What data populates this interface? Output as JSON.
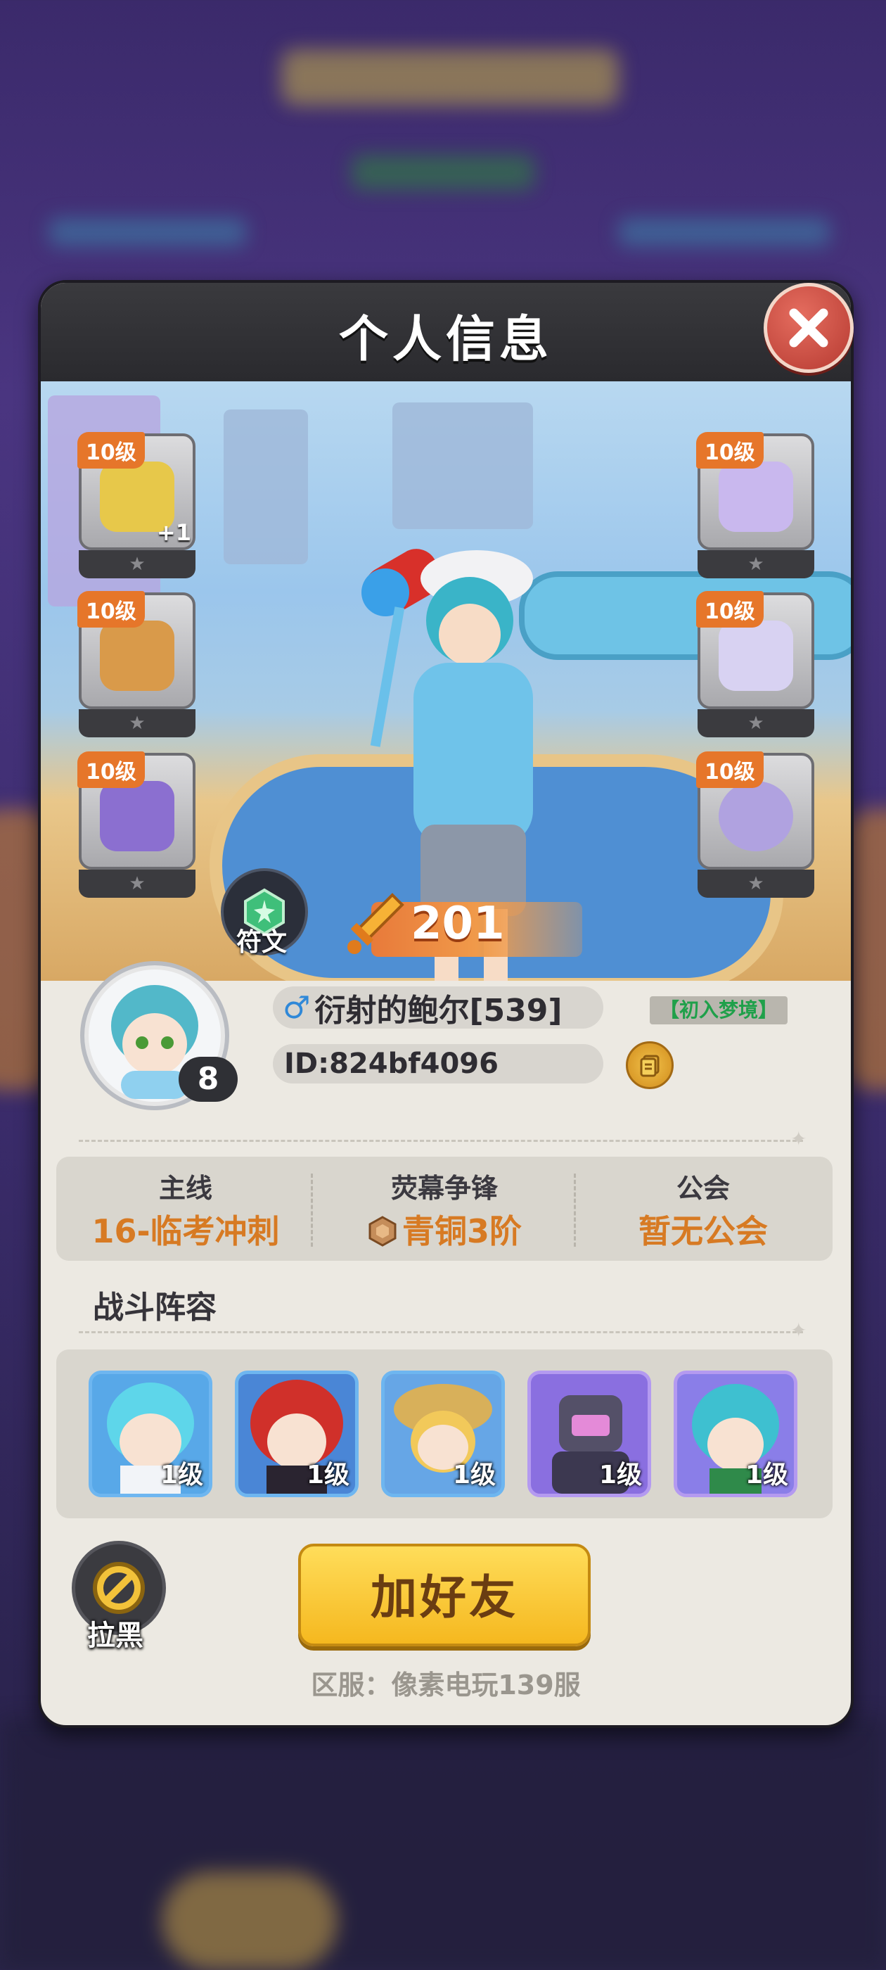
{
  "dialog": {
    "title": "个人信息"
  },
  "equipment": {
    "left": [
      {
        "level": "10级",
        "plus": "+1",
        "color": "#e7c84a"
      },
      {
        "level": "10级",
        "plus": "",
        "color": "#d99a4a"
      },
      {
        "level": "10级",
        "plus": "",
        "color": "#8b6fd0"
      }
    ],
    "right": [
      {
        "level": "10级",
        "plus": "",
        "color": "#c9b8ee"
      },
      {
        "level": "10级",
        "plus": "",
        "color": "#d8d2f2"
      },
      {
        "level": "10级",
        "plus": "",
        "color": "#b0a2e0"
      }
    ]
  },
  "rune_label": "符文",
  "power": "201",
  "player": {
    "gender_symbol": "♂",
    "name": "衍射的鲍尔[539]",
    "tag": "【初入梦境】",
    "id": "ID:824bf4096",
    "level": "8"
  },
  "stats": [
    {
      "label": "主线",
      "value": "16-临考冲刺"
    },
    {
      "label": "荧幕争锋",
      "value": "青铜3阶"
    },
    {
      "label": "公会",
      "value": "暂无公会"
    }
  ],
  "lineup_title": "战斗阵容",
  "lineup": [
    {
      "level": "1级",
      "bg": "#58a8e8",
      "hair": "#5ed6ea"
    },
    {
      "level": "1级",
      "bg": "#4a86d6",
      "hair": "#d0302a"
    },
    {
      "level": "1级",
      "bg": "#66a6e6",
      "hair": "#f2c95a"
    },
    {
      "level": "1级",
      "bg": "#8a6fe0",
      "hair": "#545068"
    },
    {
      "level": "1级",
      "bg": "#8a7ee8",
      "hair": "#3ec0d0"
    }
  ],
  "block_label": "拉黑",
  "add_friend_label": "加好友",
  "server": "区服：像素电玩139服"
}
